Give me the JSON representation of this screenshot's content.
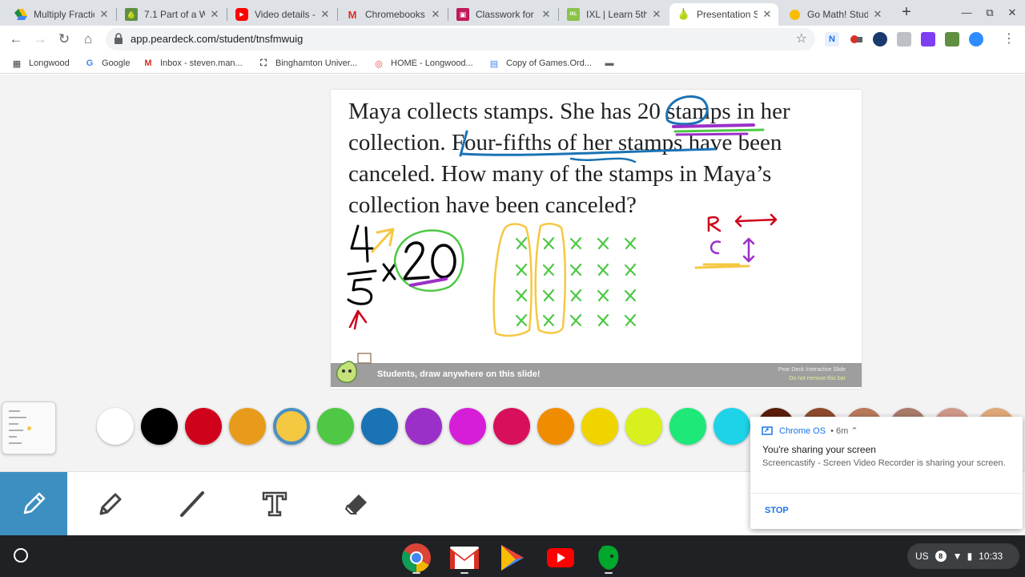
{
  "browser": {
    "tabs": [
      {
        "title": "Multiply Fractic",
        "color": "#1e8e3e",
        "glyph": "▲"
      },
      {
        "title": "7.1 Part of a W",
        "color": "#5f8f3f",
        "glyph": "▲"
      },
      {
        "title": "Video details -",
        "color": "#ff0000",
        "glyph": "▶"
      },
      {
        "title": "Chromebooks -",
        "color": "#ffffff",
        "glyph": "M"
      },
      {
        "title": "Classwork for S",
        "color": "#c2185b",
        "glyph": "▣"
      },
      {
        "title": "IXL | Learn 5th",
        "color": "#8bc34a",
        "glyph": "IXL"
      },
      {
        "title": "Presentation S",
        "color": "#ffffff",
        "glyph": "🍐"
      },
      {
        "title": "Go Math! Stude",
        "color": "#fbbc04",
        "glyph": "●"
      }
    ],
    "url": "app.peardeck.com/student/tnsfmwuig",
    "bookmarks": [
      {
        "label": "Longwood",
        "glyph": "▦"
      },
      {
        "label": "Google",
        "glyph": "G"
      },
      {
        "label": "Inbox - steven.man...",
        "glyph": "M"
      },
      {
        "label": "Binghamton Univer...",
        "glyph": "B"
      },
      {
        "label": "HOME - Longwood...",
        "glyph": "◎"
      },
      {
        "label": "Copy of Games.Ord...",
        "glyph": "▤"
      },
      {
        "label": "",
        "glyph": "▬"
      }
    ]
  },
  "slide": {
    "question": "Maya collects stamps. She has 20 stamps in her collection. Four-fifths of her stamps have been canceled. How many of the stamps in Maya’s collection have been canceled?",
    "footer_message": "Students, draw anywhere on this slide!",
    "footer_meta_1": "Pear Deck Interactive Slide",
    "footer_meta_2": "Do not remove this bar"
  },
  "palette": {
    "colors": [
      "#ffffff",
      "#000000",
      "#d0021b",
      "#e89b1a",
      "#f5c842",
      "#4ec845",
      "#1a73b4",
      "#9b30c8",
      "#d61ed8",
      "#d8105c",
      "#f08c00",
      "#f0d400",
      "#d8f01e",
      "#1ee878",
      "#1ed2e8",
      "#5a1e0a",
      "#8c4a2a",
      "#b8785a",
      "#a87a6a",
      "#d09888",
      "#e0a878"
    ],
    "selected_index": 4
  },
  "tools": [
    "pen-tool",
    "highlighter-tool",
    "line-tool",
    "text-tool",
    "eraser-tool"
  ],
  "notification": {
    "source": "Chrome OS",
    "time": "6m",
    "title": "You're sharing your screen",
    "body": "Screencastify - Screen Video Recorder is sharing your screen.",
    "action": "STOP"
  },
  "tray": {
    "locale": "US",
    "badge": "8",
    "time": "10:33"
  }
}
